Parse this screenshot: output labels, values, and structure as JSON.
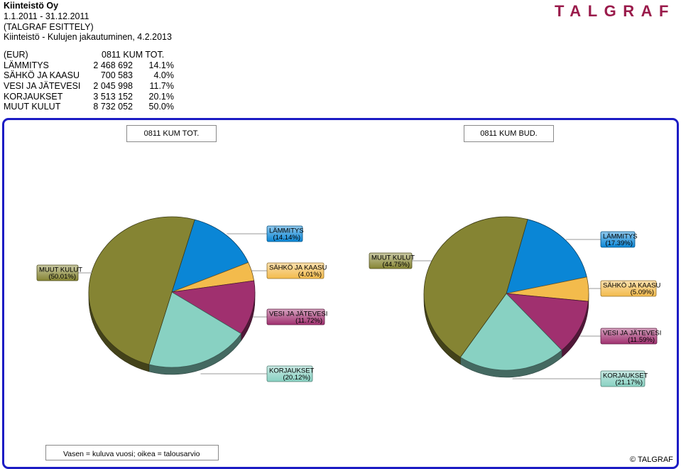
{
  "header": {
    "company": "Kiinteistö Oy",
    "period": "1.1.2011 - 31.12.2011",
    "subtitle": "(TALGRAF ESITTELY)",
    "report": "Kiinteistö - Kulujen jakautuminen, 4.2.2013",
    "logo": "TALGRAF"
  },
  "summary": {
    "unit": "(EUR)",
    "column": "0811  KUM TOT.",
    "rows": [
      {
        "label": "LÄMMITYS",
        "value": "2 468 692",
        "pct": "14.1%"
      },
      {
        "label": "SÄHKÖ JA KAASU",
        "value": "700 583",
        "pct": "4.0%"
      },
      {
        "label": "VESI JA JÄTEVESI",
        "value": "2 045 998",
        "pct": "11.7%"
      },
      {
        "label": "KORJAUKSET",
        "value": "3 513 152",
        "pct": "20.1%"
      },
      {
        "label": "MUUT KULUT",
        "value": "8 732 052",
        "pct": "50.0%"
      }
    ]
  },
  "colors": {
    "frame": "#1c1cc4",
    "logo": "#9a1b4b",
    "LÄMMITYS": "#0a86d6",
    "SÄHKÖ JA KAASU": "#f3bb4c",
    "VESI JA JÄTEVESI": "#a0306f",
    "KORJAUKSET": "#88d1c2",
    "MUUT KULUT": "#858433"
  },
  "chart_data": [
    {
      "type": "pie",
      "title": "0811  KUM TOT.",
      "categories": [
        "LÄMMITYS",
        "SÄHKÖ JA KAASU",
        "VESI JA JÄTEVESI",
        "KORJAUKSET",
        "MUUT KULUT"
      ],
      "values": [
        14.14,
        4.01,
        11.72,
        20.12,
        50.01
      ],
      "labels": [
        "(14.14%)",
        "(4.01%)",
        "(11.72%)",
        "(20.12%)",
        "(50.01%)"
      ],
      "style": "3d"
    },
    {
      "type": "pie",
      "title": "0811  KUM BUD.",
      "categories": [
        "LÄMMITYS",
        "SÄHKÖ JA KAASU",
        "VESI JA JÄTEVESI",
        "KORJAUKSET",
        "MUUT KULUT"
      ],
      "values": [
        17.39,
        5.09,
        11.59,
        21.17,
        44.75
      ],
      "labels": [
        "(17.39%)",
        "(5.09%)",
        "(11.59%)",
        "(21.17%)",
        "(44.75%)"
      ],
      "style": "3d"
    }
  ],
  "footer": {
    "note": "Vasen = kuluva vuosi; oikea = talousarvio",
    "copyright": "© TALGRAF"
  }
}
